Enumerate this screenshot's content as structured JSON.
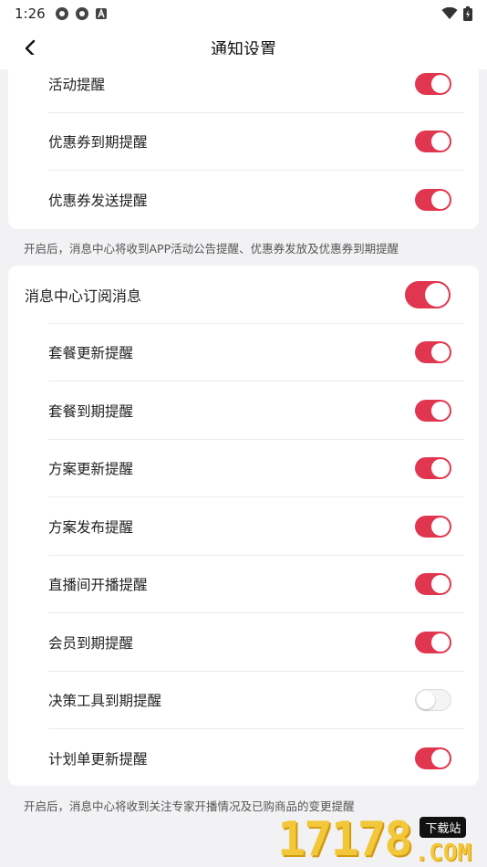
{
  "status_bar": {
    "time": "1:26"
  },
  "nav": {
    "title": "通知设置"
  },
  "group1": {
    "items": [
      {
        "label": "活动提醒",
        "on": true
      },
      {
        "label": "优惠券到期提醒",
        "on": true
      },
      {
        "label": "优惠券发送提醒",
        "on": true
      }
    ],
    "note": "开启后，消息中心将收到APP活动公告提醒、优惠券发放及优惠券到期提醒"
  },
  "group2": {
    "main": {
      "label": "消息中心订阅消息",
      "on": true
    },
    "items": [
      {
        "label": "套餐更新提醒",
        "on": true
      },
      {
        "label": "套餐到期提醒",
        "on": true
      },
      {
        "label": "方案更新提醒",
        "on": true
      },
      {
        "label": "方案发布提醒",
        "on": true
      },
      {
        "label": "直播间开播提醒",
        "on": true
      },
      {
        "label": "会员到期提醒",
        "on": true
      },
      {
        "label": "决策工具到期提醒",
        "on": false
      },
      {
        "label": "计划单更新提醒",
        "on": true
      }
    ],
    "note": "开启后，消息中心将收到关注专家开播情况及已购商品的变更提醒"
  },
  "watermark": {
    "digits": "17178",
    "tag": "下载站",
    "domain": ".COM"
  },
  "colors": {
    "accent": "#e0364f",
    "background": "#f2f2f4"
  },
  "icons": {
    "back": "chevron-left-icon",
    "wifi": "wifi-icon",
    "battery": "battery-icon"
  }
}
